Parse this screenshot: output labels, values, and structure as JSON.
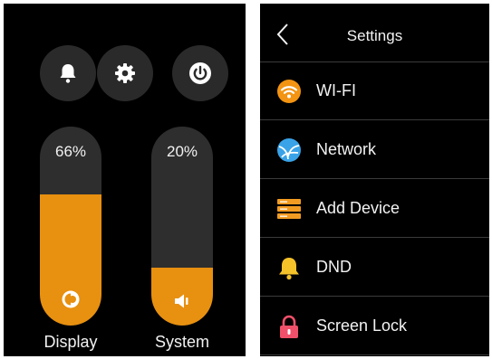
{
  "control_panel": {
    "buttons": [
      {
        "name": "notification",
        "icon": "bell-icon"
      },
      {
        "name": "settings",
        "icon": "gear-icon"
      },
      {
        "name": "power",
        "icon": "power-icon"
      }
    ],
    "sliders": [
      {
        "label": "Display",
        "value_text": "66%",
        "value": 0.66,
        "icon": "brightness-icon",
        "fill_color": "#e8900f"
      },
      {
        "label": "System",
        "value_text": "20%",
        "value": 0.2,
        "icon": "speaker-icon",
        "fill_color": "#e8900f"
      }
    ]
  },
  "settings": {
    "title": "Settings",
    "back_icon": "chevron-left-icon",
    "items": [
      {
        "label": "WI-FI",
        "icon": "wifi-icon"
      },
      {
        "label": "Network",
        "icon": "network-icon"
      },
      {
        "label": "Add Device",
        "icon": "add-device-icon"
      },
      {
        "label": "DND",
        "icon": "bell-icon"
      },
      {
        "label": "Screen Lock",
        "icon": "lock-icon"
      }
    ]
  }
}
